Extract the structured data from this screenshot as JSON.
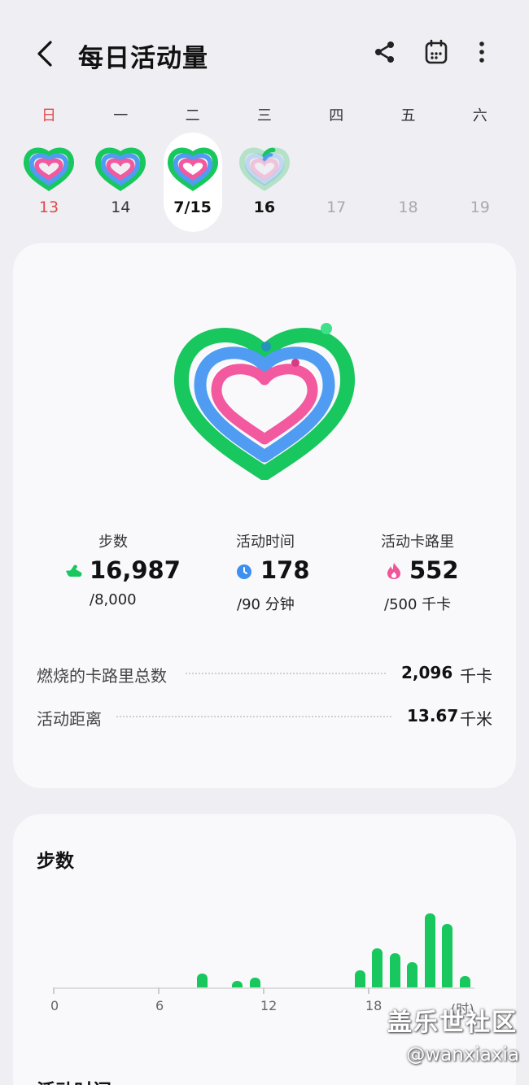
{
  "header": {
    "title": "每日活动量"
  },
  "week": {
    "days": [
      {
        "dow": "日",
        "num": "13",
        "state": "sun",
        "progress": 1.0
      },
      {
        "dow": "一",
        "num": "14",
        "state": "normal",
        "progress": 1.0
      },
      {
        "dow": "二",
        "num": "7/15",
        "state": "selected",
        "progress": 1.0
      },
      {
        "dow": "三",
        "num": "16",
        "state": "today",
        "progress": 0.2
      },
      {
        "dow": "四",
        "num": "17",
        "state": "future",
        "progress": 0
      },
      {
        "dow": "五",
        "num": "18",
        "state": "future",
        "progress": 0
      },
      {
        "dow": "六",
        "num": "19",
        "state": "future",
        "progress": 0
      }
    ]
  },
  "summary": {
    "steps": {
      "label": "步数",
      "value": "16,987",
      "goal": "/8,000",
      "icon": "shoe-icon",
      "color": "#18c75e"
    },
    "active_time": {
      "label": "活动时间",
      "value": "178",
      "goal": "/90 分钟",
      "icon": "clock-icon",
      "color": "#3d8ff0"
    },
    "calories": {
      "label": "活动卡路里",
      "value": "552",
      "goal": "/500 千卡",
      "icon": "flame-icon",
      "color": "#f0559a"
    },
    "rows": [
      {
        "label": "燃烧的卡路里总数",
        "value": "2,096",
        "unit": "千卡"
      },
      {
        "label": "活动距离",
        "value": "13.67",
        "unit": "千米"
      }
    ]
  },
  "steps_chart": {
    "title": "步数",
    "unit_label": "(时)",
    "tick_labels": [
      "0",
      "6",
      "12",
      "18"
    ],
    "chart_data": {
      "type": "bar",
      "x": [
        8,
        10,
        11,
        17,
        18,
        19,
        20,
        21,
        22,
        23
      ],
      "values": [
        0.18,
        0.08,
        0.12,
        0.22,
        0.5,
        0.44,
        0.32,
        0.95,
        0.81,
        0.15
      ],
      "xlim": [
        0,
        24
      ]
    }
  },
  "next_section": {
    "title": "活动时间"
  },
  "watermark": {
    "line1": "盖乐世社区",
    "line2": "@wanxiaxia"
  }
}
